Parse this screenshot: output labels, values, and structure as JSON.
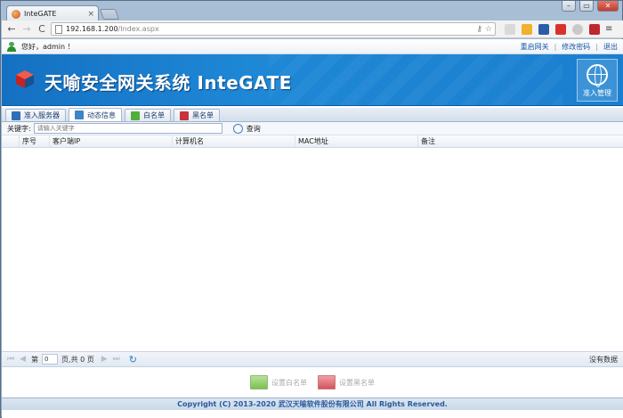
{
  "browser": {
    "tab_title": "InteGATE",
    "tab_close": "×",
    "window_buttons": [
      "–",
      "▭",
      "✕"
    ],
    "url_host": "192.168.1.200",
    "url_path": "/Index.aspx",
    "back": "←",
    "forward": "→",
    "reload": "C",
    "menu": "≡"
  },
  "topbar": {
    "greeting": "您好，admin ！",
    "links": [
      "重启网关",
      "修改密码",
      "退出"
    ],
    "separator": "|"
  },
  "banner": {
    "title": "天喻安全网关系统 InteGATE",
    "admin_label": "准入管理"
  },
  "tabs": [
    {
      "label": "准入服务器",
      "color": "#2f6fb8"
    },
    {
      "label": "动态信息",
      "color": "#3a86c8"
    },
    {
      "label": "白名单",
      "color": "#4faf3a"
    },
    {
      "label": "黑名单",
      "color": "#c8323a"
    }
  ],
  "search": {
    "label": "关键字:",
    "placeholder": "请输入关键字",
    "button": "查询"
  },
  "grid": {
    "columns": [
      "序号",
      "客户端IP",
      "计算机名",
      "MAC地址",
      "备注"
    ]
  },
  "pager": {
    "page_label": "第",
    "page_value": "0",
    "total_label": "页,共 0 页",
    "status": "没有数据"
  },
  "actions": {
    "whitelist": "设置白名单",
    "blacklist": "设置黑名单"
  },
  "footer": {
    "copyright": "Copyright (C) 2013-2020 武汉天喻软件股份有限公司 All Rights Reserved."
  }
}
